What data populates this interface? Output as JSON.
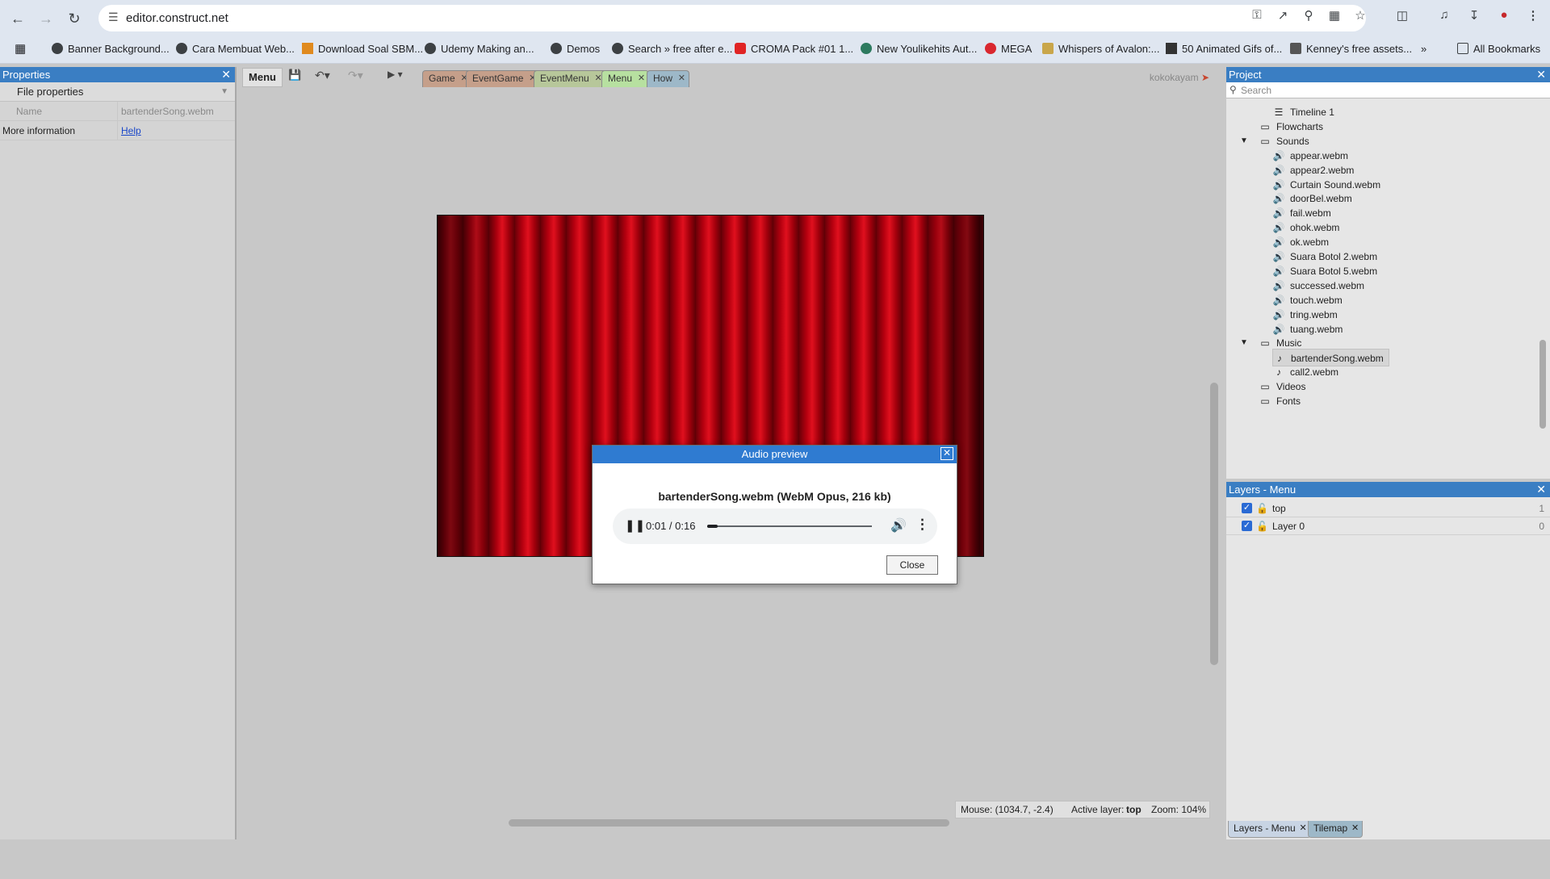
{
  "browser": {
    "url": "editor.construct.net",
    "bookmarks": [
      "Banner Background...",
      "Cara Membuat Web...",
      "Download Soal SBM...",
      "Udemy Making an...",
      "Demos",
      "Search » free after e...",
      "CROMA Pack #01 1...",
      "New Youlikehits Aut...",
      "MEGA",
      "Whispers of Avalon:...",
      "50 Animated Gifs of...",
      "Kenney's free assets..."
    ],
    "more_bookmarks": "»",
    "all_bookmarks": "All Bookmarks"
  },
  "properties": {
    "title": "Properties",
    "section": "File properties",
    "rows": [
      {
        "key": "Name",
        "value": "bartenderSong.webm"
      },
      {
        "key": "More information",
        "value": "Help"
      }
    ]
  },
  "toolbar": {
    "menu_label": "Menu",
    "user": "kokokayam"
  },
  "tabs": [
    {
      "label": "Game",
      "color": "#c59f8a"
    },
    {
      "label": "EventGame",
      "color": "#c59f8a"
    },
    {
      "label": "EventMenu",
      "color": "#b7c79a"
    },
    {
      "label": "Menu",
      "color": "#b7e0a0"
    },
    {
      "label": "How",
      "color": "#9db8c8"
    }
  ],
  "dialog": {
    "title": "Audio preview",
    "file": "bartenderSong.webm (WebM Opus, 216 kb)",
    "time": "0:01 / 0:16",
    "progress": 0.0625,
    "close_label": "Close"
  },
  "status": {
    "mouse": "Mouse: (1034.7, -2.4)",
    "active_layer_label": "Active layer:",
    "active_layer": "top",
    "zoom": "Zoom: 104%"
  },
  "project": {
    "title": "Project",
    "search_placeholder": "Search",
    "items": [
      {
        "label": "Timeline 1",
        "icon": "timeline-icon",
        "level": 2
      },
      {
        "label": "Flowcharts",
        "icon": "folder-icon",
        "level": 1
      },
      {
        "label": "Sounds",
        "icon": "folder-icon",
        "level": 1,
        "expanded": true
      },
      {
        "label": "appear.webm",
        "icon": "speaker-icon",
        "level": 2
      },
      {
        "label": "appear2.webm",
        "icon": "speaker-icon",
        "level": 2
      },
      {
        "label": "Curtain Sound.webm",
        "icon": "speaker-icon",
        "level": 2
      },
      {
        "label": "doorBel.webm",
        "icon": "speaker-icon",
        "level": 2
      },
      {
        "label": "fail.webm",
        "icon": "speaker-icon",
        "level": 2
      },
      {
        "label": "ohok.webm",
        "icon": "speaker-icon",
        "level": 2
      },
      {
        "label": "ok.webm",
        "icon": "speaker-icon",
        "level": 2
      },
      {
        "label": "Suara Botol 2.webm",
        "icon": "speaker-icon",
        "level": 2
      },
      {
        "label": "Suara Botol 5.webm",
        "icon": "speaker-icon",
        "level": 2
      },
      {
        "label": "successed.webm",
        "icon": "speaker-icon",
        "level": 2
      },
      {
        "label": "touch.webm",
        "icon": "speaker-icon",
        "level": 2
      },
      {
        "label": "tring.webm",
        "icon": "speaker-icon",
        "level": 2
      },
      {
        "label": "tuang.webm",
        "icon": "speaker-icon",
        "level": 2
      },
      {
        "label": "Music",
        "icon": "folder-icon",
        "level": 1,
        "expanded": true
      },
      {
        "label": "bartenderSong.webm",
        "icon": "music-note-icon",
        "level": 2,
        "selected": true
      },
      {
        "label": "call2.webm",
        "icon": "music-note-icon",
        "level": 2
      },
      {
        "label": "Videos",
        "icon": "folder-icon",
        "level": 1
      },
      {
        "label": "Fonts",
        "icon": "folder-icon",
        "level": 1
      }
    ]
  },
  "layers": {
    "title": "Layers - Menu",
    "rows": [
      {
        "name": "top",
        "index": "1"
      },
      {
        "name": "Layer 0",
        "index": "0"
      }
    ],
    "bottom_tabs": [
      "Layers - Menu",
      "Tilemap"
    ]
  }
}
